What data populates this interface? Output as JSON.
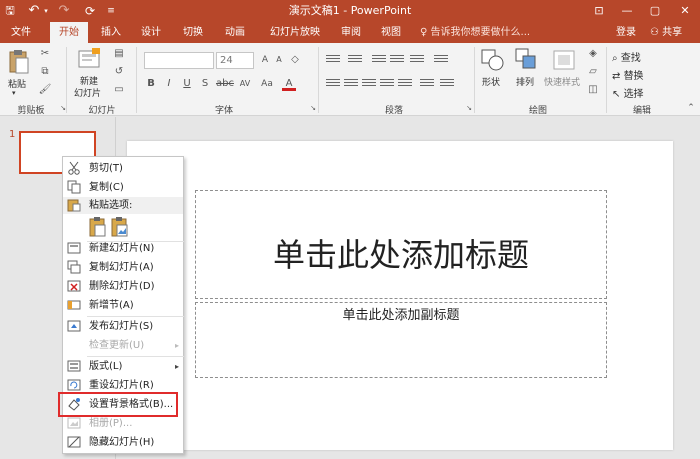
{
  "window": {
    "title": "演示文稿1 - PowerPoint",
    "minimize": "—",
    "restore": "▢",
    "close": "✕",
    "ribbon_display": "⊡"
  },
  "quick_access": {
    "save": "🖫",
    "undo": "↶",
    "redo": "↷",
    "from_start": "⟳"
  },
  "tabs": [
    {
      "label": "文件"
    },
    {
      "label": "开始"
    },
    {
      "label": "插入"
    },
    {
      "label": "设计"
    },
    {
      "label": "切换"
    },
    {
      "label": "动画"
    },
    {
      "label": "幻灯片放映"
    },
    {
      "label": "审阅"
    },
    {
      "label": "视图"
    }
  ],
  "tell_me": "告诉我你想要做什么...",
  "account": {
    "signin": "登录",
    "share": "共享"
  },
  "ribbon": {
    "clipboard": {
      "label": "剪贴板",
      "paste": "粘贴"
    },
    "slides": {
      "label": "幻灯片",
      "new_slide_1": "新建",
      "new_slide_2": "幻灯片"
    },
    "font": {
      "label": "字体",
      "font_name": "",
      "font_size": "24",
      "bold": "B",
      "italic": "I",
      "underline": "U",
      "strike": "S",
      "spacing": "AV",
      "aa": "Aa",
      "color": "A"
    },
    "paragraph": {
      "label": "段落"
    },
    "drawing": {
      "label": "绘图",
      "shapes": "形状",
      "arrange": "排列",
      "quick_styles": "快速样式"
    },
    "editing": {
      "label": "编辑",
      "find": "查找",
      "replace": "替换",
      "select": "选择"
    }
  },
  "thumbnails": [
    {
      "number": "1"
    }
  ],
  "slide": {
    "title_placeholder": "单击此处添加标题",
    "subtitle_placeholder": "单击此处添加副标题"
  },
  "context_menu": {
    "items": [
      {
        "label": "剪切(T)",
        "icon": "scissors-icon"
      },
      {
        "label": "复制(C)",
        "icon": "copy-icon"
      },
      {
        "label": "粘贴选项:",
        "icon": "paste-icon"
      },
      {
        "label": "新建幻灯片(N)",
        "icon": "new-slide-icon"
      },
      {
        "label": "复制幻灯片(A)",
        "icon": "duplicate-slide-icon"
      },
      {
        "label": "删除幻灯片(D)",
        "icon": "delete-slide-icon"
      },
      {
        "label": "新增节(A)",
        "icon": "section-icon"
      },
      {
        "label": "发布幻灯片(S)",
        "icon": "publish-icon"
      },
      {
        "label": "检查更新(U)",
        "icon": "check-updates-icon"
      },
      {
        "label": "版式(L)",
        "icon": "layout-icon"
      },
      {
        "label": "重设幻灯片(R)",
        "icon": "reset-slide-icon"
      },
      {
        "label": "设置背景格式(B)...",
        "icon": "format-background-icon"
      },
      {
        "label": "相册(P)...",
        "icon": "photo-album-icon"
      },
      {
        "label": "隐藏幻灯片(H)",
        "icon": "hide-slide-icon"
      }
    ]
  },
  "colors": {
    "accent": "#b7472a",
    "highlight_box": "#e02b2b"
  }
}
